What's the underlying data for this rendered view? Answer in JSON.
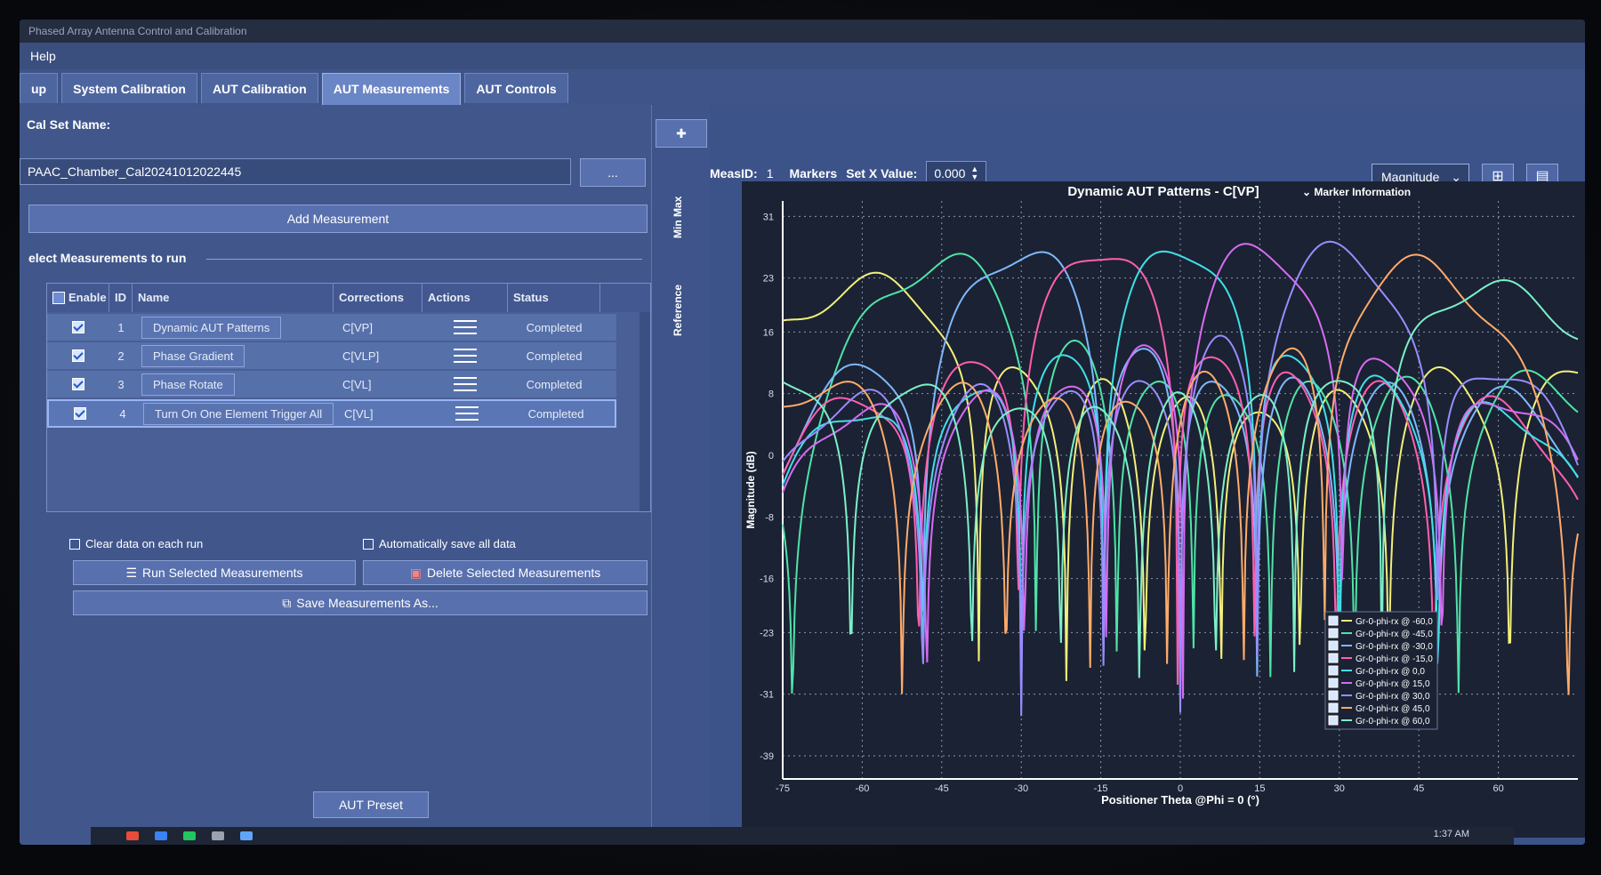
{
  "window": {
    "title": "Phased Array Antenna Control and Calibration"
  },
  "menu": {
    "help": "Help"
  },
  "tabs": [
    {
      "label": "up",
      "active": false
    },
    {
      "label": "System Calibration",
      "active": false
    },
    {
      "label": "AUT Calibration",
      "active": false
    },
    {
      "label": "AUT Measurements",
      "active": true
    },
    {
      "label": "AUT Controls",
      "active": false
    }
  ],
  "left": {
    "cal_set_label": "Cal Set Name:",
    "cal_set_value": "PAAC_Chamber_Cal20241012022445",
    "browse_label": "...",
    "add_measurement": "Add Measurement",
    "select_label": "elect Measurements to run",
    "columns": [
      "Enable",
      "ID",
      "Name",
      "Corrections",
      "Actions",
      "Status"
    ],
    "rows": [
      {
        "enabled": true,
        "id": "1",
        "name": "Dynamic AUT Patterns",
        "corrections": "C[VP]",
        "status": "Completed",
        "selected": false
      },
      {
        "enabled": true,
        "id": "2",
        "name": "Phase Gradient",
        "corrections": "C[VLP]",
        "status": "Completed",
        "selected": false
      },
      {
        "enabled": true,
        "id": "3",
        "name": "Phase Rotate",
        "corrections": "C[VL]",
        "status": "Completed",
        "selected": false
      },
      {
        "enabled": true,
        "id": "4",
        "name": "Turn On One Element Trigger All",
        "corrections": "C[VL]",
        "status": "Completed",
        "selected": true
      }
    ],
    "clear_data": "Clear data on each run",
    "auto_save": "Automatically save all data",
    "run_selected": "Run Selected Measurements",
    "delete_selected": "Delete Selected Measurements",
    "save_as": "Save Measurements As...",
    "aut_preset": "AUT Preset"
  },
  "side_tabs": {
    "minmax": "Min Max",
    "reference": "Reference"
  },
  "plot_toolbar": {
    "meas_id_label": "MeasID:",
    "meas_id_value": "1",
    "markers_label": "Markers",
    "set_x_label": "Set X Value:",
    "set_x_value": "0.000",
    "view_mode": "Magnitude",
    "marker_info": "Marker Information"
  },
  "taskbar": {
    "clock": "1:37 AM"
  },
  "chart_data": {
    "type": "line",
    "title": "Dynamic AUT Patterns - C[VP]",
    "xlabel": "Positioner Theta @Phi = 0 (°)",
    "ylabel": "Magnitude (dB)",
    "xlim": [
      -75,
      75
    ],
    "ylim": [
      -42,
      33
    ],
    "xticks": [
      "-75",
      "-60",
      "-45",
      "-30",
      "-15",
      "0",
      "15",
      "30",
      "45",
      "60"
    ],
    "yticks": [
      "31",
      "23",
      "16",
      "8",
      "0",
      "-8",
      "-16",
      "-23",
      "-31",
      "-39"
    ],
    "grid": true,
    "legend_position": "bottom-right",
    "series": [
      {
        "name": "Gr-0-phi-rx @ -60,0",
        "steer": -60,
        "peak": 25,
        "color": "#f2f07a"
      },
      {
        "name": "Gr-0-phi-rx @ -45,0",
        "steer": -45,
        "peak": 26.5,
        "color": "#4fe3a8"
      },
      {
        "name": "Gr-0-phi-rx @ -30,0",
        "steer": -30,
        "peak": 27,
        "color": "#7fb8ff"
      },
      {
        "name": "Gr-0-phi-rx @ -15,0",
        "steer": -15,
        "peak": 27,
        "color": "#ff5fb0"
      },
      {
        "name": "Gr-0-phi-rx @ 0,0",
        "steer": 0,
        "peak": 27,
        "color": "#3fe0e8"
      },
      {
        "name": "Gr-0-phi-rx @ 15,0",
        "steer": 15,
        "peak": 27,
        "color": "#d66cf2"
      },
      {
        "name": "Gr-0-phi-rx @ 30,0",
        "steer": 30,
        "peak": 27,
        "color": "#9a8cff"
      },
      {
        "name": "Gr-0-phi-rx @ 45,0",
        "steer": 45,
        "peak": 26,
        "color": "#ffab6a"
      },
      {
        "name": "Gr-0-phi-rx @ 60,0",
        "steer": 60,
        "peak": 24.5,
        "color": "#7cf0c8"
      }
    ]
  }
}
